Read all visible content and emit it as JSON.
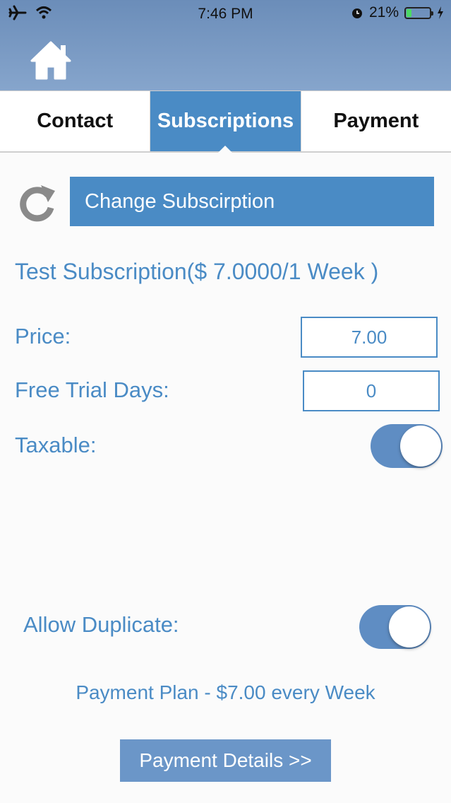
{
  "status_bar": {
    "time": "7:46 PM",
    "battery_percent": "21%",
    "battery_level": 0.21,
    "icons": [
      "airplane-icon",
      "wifi-icon",
      "alarm-icon",
      "battery-icon",
      "charging-bolt-icon"
    ]
  },
  "header": {
    "home_icon": "home-icon"
  },
  "tabs": [
    {
      "label": "Contact",
      "active": false
    },
    {
      "label": "Subscriptions",
      "active": true
    },
    {
      "label": "Payment",
      "active": false
    }
  ],
  "change_subscription": {
    "label": "Change Subscirption",
    "icon": "refresh-icon"
  },
  "subscription": {
    "title": "Test Subscription($ 7.0000/1 Week )"
  },
  "fields": {
    "price": {
      "label": "Price:",
      "value": "7.00"
    },
    "free_trial_days": {
      "label": "Free Trial Days:",
      "value": "0"
    },
    "taxable": {
      "label": "Taxable:",
      "on": true
    }
  },
  "allow_duplicate": {
    "label": "Allow Duplicate:",
    "on": true
  },
  "payment_plan": "Payment Plan - $7.00 every Week",
  "payment_details_button": "Payment Details >>",
  "colors": {
    "accent": "#4a8bc5",
    "header": "#7a9bc4",
    "toggle_on": "#5f8dc3"
  }
}
